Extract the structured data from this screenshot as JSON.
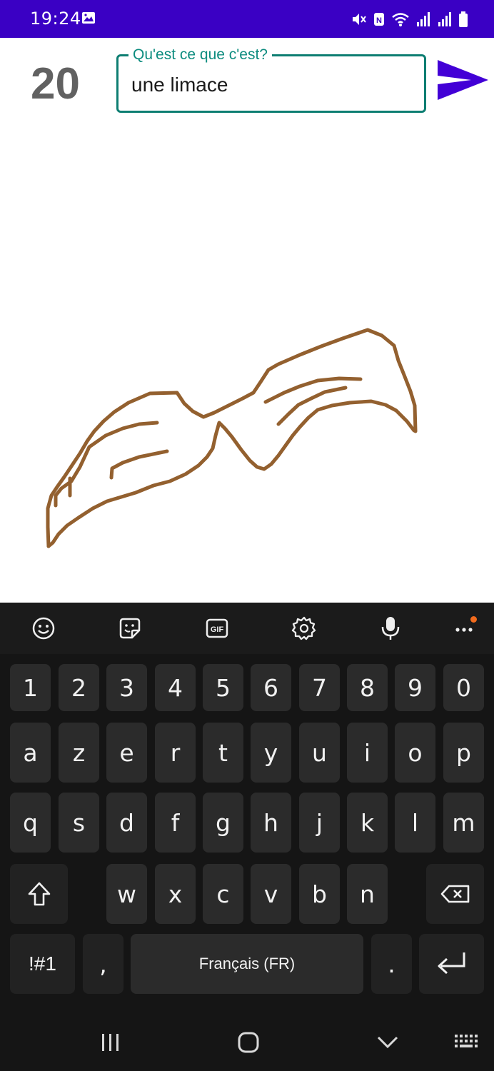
{
  "status_bar": {
    "time": "19:24",
    "icons": [
      "image-icon",
      "mute-icon",
      "nfc-icon",
      "wifi-icon",
      "signal-icon",
      "signal-icon",
      "battery-icon"
    ],
    "background": "#3a00c4"
  },
  "game": {
    "countdown": "20",
    "guess_label": "Qu'est ce que c'est?",
    "guess_value": "une limace",
    "accent": "#0d7e72",
    "send_color": "#4200d6"
  },
  "drawing": {
    "stroke_color": "#93602f",
    "description_icon": "freehand-drawing"
  },
  "keyboard": {
    "toolbar": [
      "emoji-icon",
      "sticker-icon",
      "gif-icon",
      "gear-icon",
      "microphone-icon",
      "more-icon"
    ],
    "gif_label": "GIF",
    "row_numbers": [
      "1",
      "2",
      "3",
      "4",
      "5",
      "6",
      "7",
      "8",
      "9",
      "0"
    ],
    "row_1": [
      "a",
      "z",
      "e",
      "r",
      "t",
      "y",
      "u",
      "i",
      "o",
      "p"
    ],
    "row_2": [
      "q",
      "s",
      "d",
      "f",
      "g",
      "h",
      "j",
      "k",
      "l",
      "m"
    ],
    "row_3": [
      "w",
      "x",
      "c",
      "v",
      "b",
      "n"
    ],
    "symbols_label": "!#1",
    "comma_label": ",",
    "space_label": "Français (FR)",
    "period_label": "."
  },
  "nav_bar": {
    "buttons": [
      "recents-icon",
      "home-icon",
      "back-icon",
      "keyboard-icon"
    ]
  }
}
